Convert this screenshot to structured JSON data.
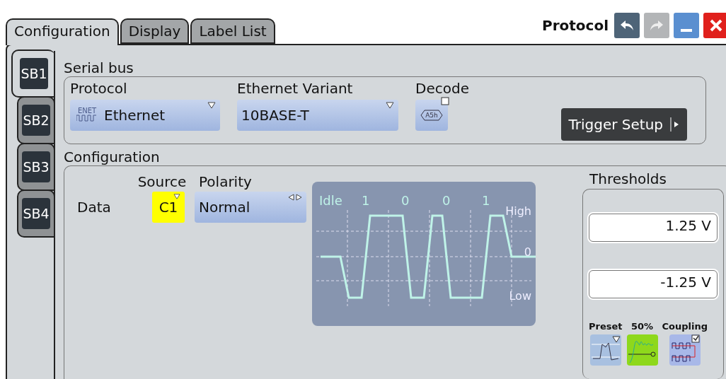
{
  "tabs": [
    {
      "label": "Configuration",
      "selected": true
    },
    {
      "label": "Display",
      "selected": false
    },
    {
      "label": "Label List",
      "selected": false
    }
  ],
  "window": {
    "title": "Protocol",
    "undo_disabled": false,
    "redo_disabled": true
  },
  "side_tabs": [
    {
      "label": "SB1",
      "selected": true
    },
    {
      "label": "SB2",
      "selected": false
    },
    {
      "label": "SB3",
      "selected": false
    },
    {
      "label": "SB4",
      "selected": false
    }
  ],
  "serial_bus": {
    "title": "Serial bus",
    "protocol": {
      "label": "Protocol",
      "badge": "ENET",
      "value": "Ethernet"
    },
    "variant": {
      "label": "Ethernet Variant",
      "value": "10BASE-T"
    },
    "decode": {
      "label": "Decode",
      "icon_text": "A5h",
      "checked": false
    },
    "trigger_button": "Trigger Setup"
  },
  "configuration": {
    "title": "Configuration",
    "source_label": "Source",
    "polarity_label": "Polarity",
    "row_label": "Data",
    "source": {
      "value": "C1",
      "color": "#ffff00"
    },
    "polarity": "Normal",
    "diagram": {
      "bits": [
        "Idle",
        "1",
        "0",
        "0",
        "1"
      ],
      "levels": [
        "High",
        "0",
        "Low"
      ]
    },
    "thresholds": {
      "title": "Thresholds",
      "values": [
        "1.25 V",
        "-1.25 V"
      ],
      "buttons": [
        {
          "kind": "preset",
          "label": "Preset"
        },
        {
          "kind": "fifty",
          "label": "50%"
        },
        {
          "kind": "coupling",
          "label": "Coupling",
          "checked": true
        }
      ]
    }
  }
}
